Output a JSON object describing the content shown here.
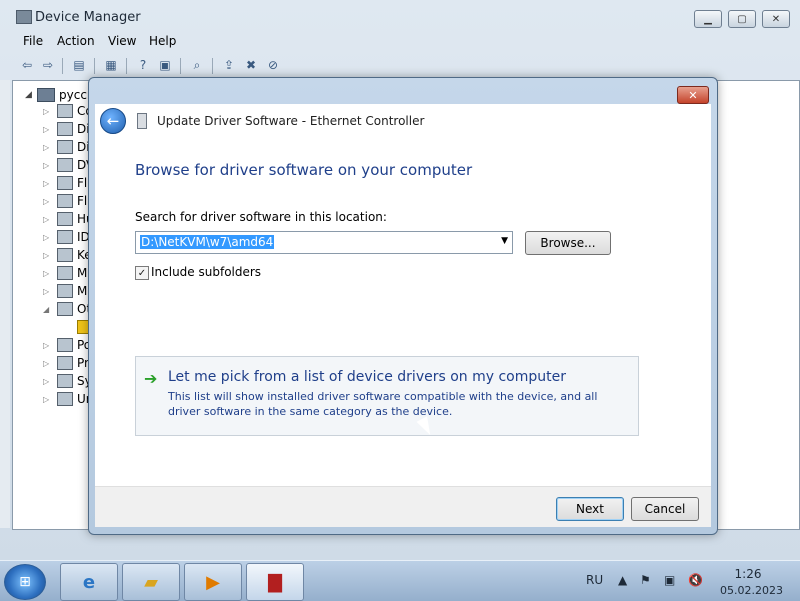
{
  "device_manager": {
    "title": "Device Manager",
    "menu": [
      "File",
      "Action",
      "View",
      "Help"
    ],
    "tree": {
      "root_label": "русск",
      "nodes": [
        {
          "label": "Co",
          "icon": "computer-icon"
        },
        {
          "label": "Di",
          "icon": "disk-drive-icon"
        },
        {
          "label": "Di",
          "icon": "display-adapter-icon"
        },
        {
          "label": "DV",
          "icon": "dvd-drive-icon"
        },
        {
          "label": "Fl",
          "icon": "floppy-controller-icon"
        },
        {
          "label": "Fl",
          "icon": "floppy-drive-icon"
        },
        {
          "label": "Hu",
          "icon": "hid-icon"
        },
        {
          "label": "ID",
          "icon": "ide-controller-icon"
        },
        {
          "label": "Ke",
          "icon": "keyboard-icon"
        },
        {
          "label": "Mi",
          "icon": "mouse-icon"
        },
        {
          "label": "Mo",
          "icon": "monitor-icon"
        },
        {
          "label": "Ot",
          "icon": "other-devices-icon"
        },
        {
          "label": "Po",
          "icon": "ports-icon"
        },
        {
          "label": "Pr",
          "icon": "processor-icon"
        },
        {
          "label": "Sy",
          "icon": "system-devices-icon"
        },
        {
          "label": "Ur",
          "icon": "usb-controller-icon"
        }
      ]
    }
  },
  "dialog": {
    "title": "Update Driver Software - Ethernet Controller",
    "heading": "Browse for driver software on your computer",
    "search_label": "Search for driver software in this location:",
    "path_value": "D:\\NetKVM\\w7\\amd64",
    "browse_label": "Browse...",
    "include_subfolders_label": "Include subfolders",
    "include_subfolders_checked": true,
    "pick_title": "Let me pick from a list of device drivers on my computer",
    "pick_description": "This list will show installed driver software compatible with the device, and all driver software in the same category as the device.",
    "next_label": "Next",
    "cancel_label": "Cancel"
  },
  "taskbar": {
    "language": "RU",
    "time": "1:26",
    "date": "05.02.2023"
  },
  "colors": {
    "heading_blue": "#1f3f8a",
    "selection_blue": "#3399ff",
    "close_red": "#c4432b"
  }
}
